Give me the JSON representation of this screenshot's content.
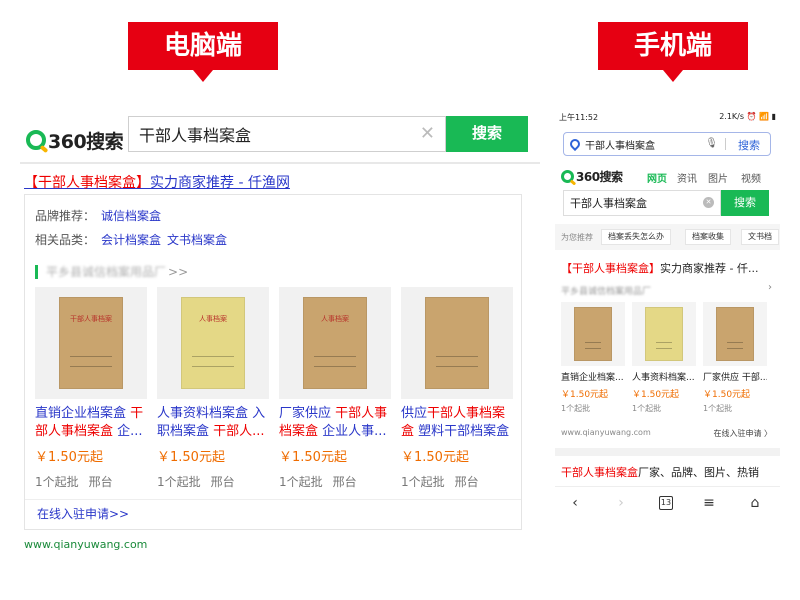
{
  "banners": {
    "pc": "电脑端",
    "mobile": "手机端"
  },
  "pc": {
    "logo": "360搜索",
    "query": "干部人事档案盒",
    "search_button": "搜索",
    "result_title": {
      "hl": "【干部人事档案盒】",
      "rest": "实力商家推荐 - 仟渔网"
    },
    "brand_label": "品牌推荐：",
    "brand_links": [
      "诚信档案盒"
    ],
    "related_label": "相关品类：",
    "related_links": [
      "会计档案盒",
      "文书档案盒"
    ],
    "shop_name": "平乡县诚信档案用品厂",
    "shop_more": ">>",
    "products": [
      {
        "name_pre": "直销企业档案盒 ",
        "name_hl": "干部人事档案盒",
        "name_post": " 企...",
        "folder": "kraft",
        "folder_text": "干部人事档案",
        "price": "￥1.50元起",
        "moq": "1个起批",
        "platform": "邢台"
      },
      {
        "name_pre": "人事资料档案盒 入职档案盒 ",
        "name_hl": "干部人...",
        "name_post": "",
        "folder": "yellow",
        "folder_text": "人事档案",
        "price": "￥1.50元起",
        "moq": "1个起批",
        "platform": "邢台"
      },
      {
        "name_pre": "厂家供应 ",
        "name_hl": "干部人事档案盒",
        "name_post": " 企业人事...",
        "folder": "kraft",
        "folder_text": "人事档案",
        "price": "￥1.50元起",
        "moq": "1个起批",
        "platform": "邢台"
      },
      {
        "name_pre": "供应",
        "name_hl": "干部人事档案盒",
        "name_post": " 塑料干部档案盒 p...",
        "folder": "kraft",
        "folder_text": "",
        "price": "￥1.50元起",
        "moq": "1个起批",
        "platform": "邢台"
      }
    ],
    "apply_link": "在线入驻申请>>",
    "url": "www.qianyuwang.com"
  },
  "mobile": {
    "status_time": "上午11:52",
    "status_right": "2.1K/s ⏰ 📶 ▮",
    "address_query": "干部人事档案盒",
    "address_go": "搜索",
    "logo": "360搜索",
    "tabs": [
      "网页",
      "资讯",
      "图片",
      "视频"
    ],
    "query": "干部人事档案盒",
    "search_button": "搜索",
    "suggest_label": "为您推荐",
    "suggestions": [
      "档案丢失怎么办",
      "档案收集",
      "文书档"
    ],
    "result_title": {
      "hl": "【干部人事档案盒】",
      "rest": "实力商家推荐 - 仟..."
    },
    "shop_name": "平乡县诚信档案用品厂",
    "products": [
      {
        "name": "直销企业档案...",
        "folder": "kraft",
        "price": "￥1.50元起",
        "moq": "1个起批"
      },
      {
        "name": "人事资料档案...",
        "folder": "yellow",
        "price": "￥1.50元起",
        "moq": "1个起批"
      },
      {
        "name": "厂家供应 干部...",
        "folder": "kraft",
        "price": "￥1.50元起",
        "moq": "1个起批"
      }
    ],
    "url": "www.qianyuwang.com",
    "apply_link": "在线入驻申请 〉",
    "result2": {
      "hl": "干部人事档案盒",
      "rest": "厂家、品牌、图片、热销"
    },
    "tab_count": "13"
  }
}
